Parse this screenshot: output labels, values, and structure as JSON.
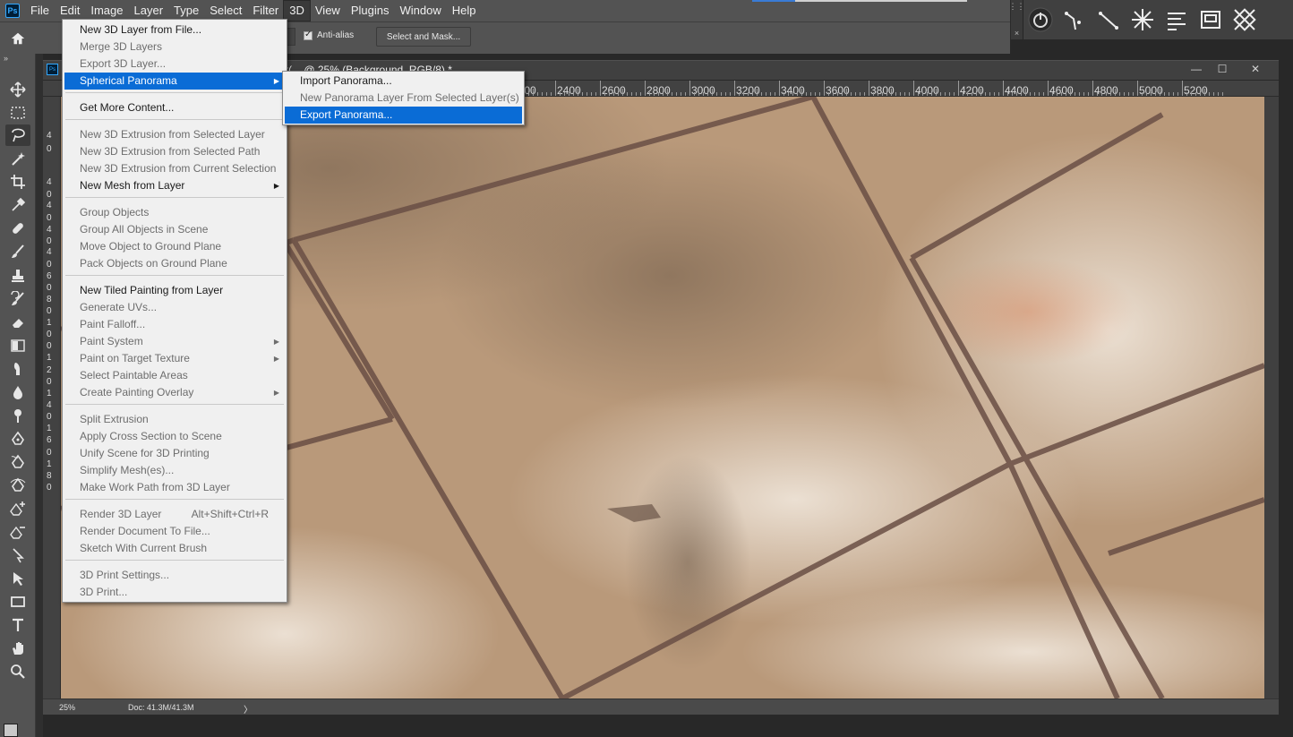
{
  "app": {
    "logo": "Ps"
  },
  "menubar": {
    "items": [
      "File",
      "Edit",
      "Image",
      "Layer",
      "Type",
      "Select",
      "Filter",
      "3D",
      "View",
      "Plugins",
      "Window",
      "Help"
    ],
    "active": "3D"
  },
  "options_bar": {
    "antialias_label": "Anti-alias",
    "antialias_checked": true,
    "select_mask_label": "Select and Mask..."
  },
  "plugin_panel": {
    "icons": [
      "power-icon",
      "pen-node-icon",
      "line-node-icon",
      "snowflake-icon",
      "align-lines-icon",
      "frame-icon",
      "crossed-square-icon"
    ]
  },
  "document": {
    "title": "r(... @ 25% (Background, RGB/8) *",
    "ruler_labels": [
      "00",
      "2200",
      "2400",
      "2600",
      "2800",
      "3000",
      "3200",
      "3400",
      "3600",
      "3800",
      "4000",
      "4200",
      "4400",
      "4600",
      "4800",
      "5000",
      "5200"
    ],
    "zoom": "25%",
    "doc_size": "Doc: 41.3M/41.3M",
    "status_arrow": "〉"
  },
  "strip_digits": [
    "4",
    "0",
    "4",
    "0",
    "4",
    "0",
    "4",
    "0",
    "4",
    "0",
    "6",
    "0",
    "8",
    "0",
    "1",
    "0",
    "0",
    "1",
    "2",
    "0",
    "1",
    "4",
    "0",
    "1",
    "6",
    "0",
    "1",
    "8",
    "0"
  ],
  "menu_3d": {
    "items": [
      {
        "label": "New 3D Layer from File...",
        "enabled": true
      },
      {
        "label": "Merge 3D Layers",
        "enabled": false
      },
      {
        "label": "Export 3D Layer...",
        "enabled": false
      },
      {
        "label": "Spherical Panorama",
        "enabled": true,
        "submenu": true,
        "highlighted": true
      },
      {
        "label": "Get More Content...",
        "enabled": true
      },
      {
        "label": "New 3D Extrusion from Selected Layer",
        "enabled": false
      },
      {
        "label": "New 3D Extrusion from Selected Path",
        "enabled": false
      },
      {
        "label": "New 3D Extrusion from Current Selection",
        "enabled": false
      },
      {
        "label": "New Mesh from Layer",
        "enabled": true,
        "submenu": true
      },
      {
        "label": "Group Objects",
        "enabled": false
      },
      {
        "label": "Group All Objects in Scene",
        "enabled": false
      },
      {
        "label": "Move Object to Ground Plane",
        "enabled": false
      },
      {
        "label": "Pack Objects on Ground Plane",
        "enabled": false
      },
      {
        "label": "New Tiled Painting from Layer",
        "enabled": true
      },
      {
        "label": "Generate UVs...",
        "enabled": false
      },
      {
        "label": "Paint Falloff...",
        "enabled": false
      },
      {
        "label": "Paint System",
        "enabled": false,
        "submenu": true
      },
      {
        "label": "Paint on Target Texture",
        "enabled": false,
        "submenu": true
      },
      {
        "label": "Select Paintable Areas",
        "enabled": false
      },
      {
        "label": "Create Painting Overlay",
        "enabled": false,
        "submenu": true
      },
      {
        "label": "Split Extrusion",
        "enabled": false
      },
      {
        "label": "Apply Cross Section to Scene",
        "enabled": false
      },
      {
        "label": "Unify Scene for 3D Printing",
        "enabled": false
      },
      {
        "label": "Simplify Mesh(es)...",
        "enabled": false
      },
      {
        "label": "Make Work Path from 3D Layer",
        "enabled": false
      },
      {
        "label": "Render 3D Layer",
        "enabled": false,
        "shortcut": "Alt+Shift+Ctrl+R"
      },
      {
        "label": "Render Document To File...",
        "enabled": false
      },
      {
        "label": "Sketch With Current Brush",
        "enabled": false
      },
      {
        "label": "3D Print Settings...",
        "enabled": false
      },
      {
        "label": "3D Print...",
        "enabled": false
      }
    ]
  },
  "submenu_panorama": {
    "items": [
      {
        "label": "Import Panorama...",
        "enabled": true
      },
      {
        "label": "New Panorama Layer From Selected Layer(s)",
        "enabled": false
      },
      {
        "label": "Export Panorama...",
        "enabled": true,
        "highlighted": true
      }
    ]
  },
  "tools": [
    "move-tool-icon",
    "marquee-tool-icon",
    "lasso-tool-icon",
    "magic-wand-icon",
    "crop-tool-icon",
    "eyedropper-icon",
    "healing-brush-icon",
    "brush-tool-icon",
    "clone-stamp-icon",
    "history-brush-icon",
    "eraser-icon",
    "gradient-icon",
    "smudge-icon",
    "dodge-icon",
    "burn-icon",
    "pen-tool-icon",
    "freeform-pen-icon",
    "curvature-pen-icon",
    "add-anchor-icon",
    "delete-anchor-icon",
    "path-select-icon",
    "direct-select-icon",
    "rectangle-tool-icon",
    "type-tool-icon",
    "hand-tool-icon",
    "zoom-tool-icon"
  ],
  "colors": {
    "menu_highlight": "#0a6cd6",
    "menubar_bg": "#535353"
  }
}
